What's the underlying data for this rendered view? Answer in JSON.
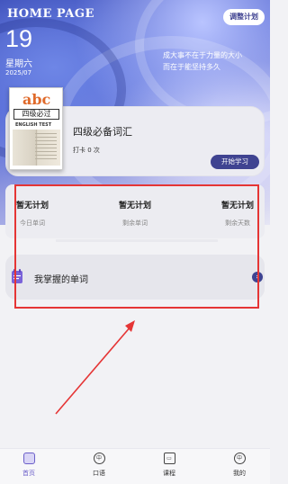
{
  "header": {
    "title": "HOME PAGE",
    "adjust_button": "调整计划",
    "day": "19",
    "weekday": "星期六",
    "year_month": "2025/07",
    "motto_line1": "成大事不在于力量的大小",
    "motto_line2": "而在于能坚持多久"
  },
  "book": {
    "cover_abc": "abc",
    "cover_title": "四级必过",
    "cover_subtitle": "ENGLISH TEST",
    "name": "四级必备词汇",
    "checkin": "打卡 0 次",
    "start_button": "开始学习"
  },
  "stats": [
    {
      "value": "暂无计划",
      "label": "今日单词"
    },
    {
      "value": "暂无计划",
      "label": "剩余单词"
    },
    {
      "value": "暂无计划",
      "label": "剩余天数"
    }
  ],
  "mastered": {
    "label": "我掌握的单词",
    "arrow": "›"
  },
  "tabs": [
    {
      "label": "首页",
      "icon": "home-icon",
      "glyph": ""
    },
    {
      "label": "口语",
      "icon": "speaking-icon",
      "glyph": "中"
    },
    {
      "label": "课程",
      "icon": "course-icon",
      "glyph": "▭"
    },
    {
      "label": "我的",
      "icon": "profile-icon",
      "glyph": "中"
    }
  ],
  "colors": {
    "accent": "#3f4391",
    "active_tab": "#6b5fc9",
    "annotation_red": "#e53535"
  }
}
